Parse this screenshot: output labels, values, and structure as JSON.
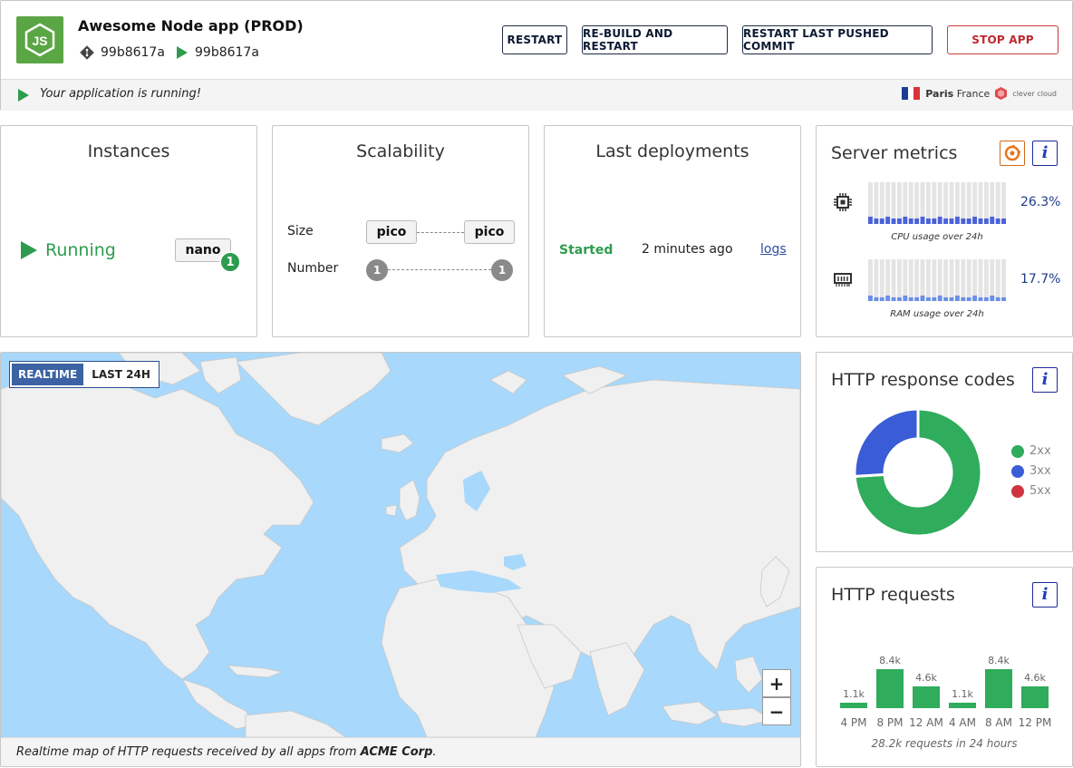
{
  "app": {
    "name": "Awesome Node app (PROD)",
    "commit_current": "99b8617a",
    "commit_running": "99b8617a",
    "logo_text": "JS"
  },
  "actions": {
    "restart": "RESTART",
    "rebuild": "RE-BUILD AND RESTART",
    "restart_last": "RESTART LAST PUSHED COMMIT",
    "stop": "STOP APP"
  },
  "status": {
    "message": "Your application is running!",
    "zone_city": "Paris",
    "zone_country": "France",
    "provider": "clever cloud"
  },
  "instances": {
    "title": "Instances",
    "state": "Running",
    "flavor": "nano",
    "count": "1"
  },
  "scalability": {
    "title": "Scalability",
    "size_label": "Size",
    "size_min": "pico",
    "size_max": "pico",
    "number_label": "Number",
    "number_min": "1",
    "number_max": "1"
  },
  "deployments": {
    "title": "Last deployments",
    "state": "Started",
    "time": "2 minutes ago",
    "logs": "logs"
  },
  "metrics": {
    "title": "Server metrics",
    "cpu_value": "26.3%",
    "cpu_label": "CPU usage over 24h",
    "cpu_level": 0.263,
    "ram_value": "17.7%",
    "ram_label": "RAM usage over 24h",
    "ram_level": 0.177
  },
  "response_codes": {
    "title": "HTTP response codes",
    "legend": [
      {
        "label": "2xx",
        "color": "#2fac5c"
      },
      {
        "label": "3xx",
        "color": "#3a5cd6"
      },
      {
        "label": "5xx",
        "color": "#d0343e"
      }
    ],
    "colors": {
      "2xx": "#2fac5c",
      "3xx": "#3a5cd6",
      "5xx": "#d0343e"
    }
  },
  "http_requests": {
    "title": "HTTP requests",
    "summary": "28.2k requests in 24 hours"
  },
  "map": {
    "tab_realtime": "REALTIME",
    "tab_last24": "LAST 24H",
    "zoom_in": "+",
    "zoom_out": "−",
    "footer_prefix": "Realtime map of HTTP requests received by all apps from ",
    "footer_org": "ACME Corp",
    "footer_suffix": "."
  },
  "chart_data": [
    {
      "type": "pie",
      "title": "HTTP response codes",
      "categories": [
        "2xx",
        "3xx",
        "5xx"
      ],
      "values": [
        74,
        26,
        0
      ]
    },
    {
      "type": "bar",
      "title": "HTTP requests",
      "categories": [
        "4 PM",
        "8 PM",
        "12 AM",
        "4 AM",
        "8 AM",
        "12 PM"
      ],
      "values": [
        1.1,
        8.4,
        4.6,
        1.1,
        8.4,
        4.6
      ],
      "data_labels": [
        "1.1k",
        "8.4k",
        "4.6k",
        "1.1k",
        "8.4k",
        "4.6k"
      ],
      "ylabel": "",
      "ylim": [
        0,
        8.4
      ]
    }
  ]
}
